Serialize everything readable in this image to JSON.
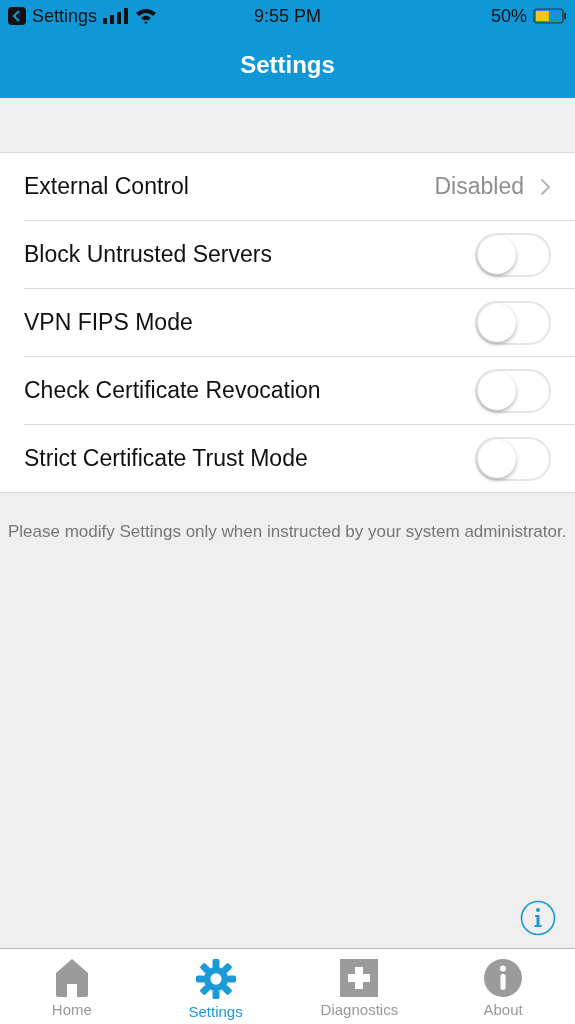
{
  "status_bar": {
    "back_label": "Settings",
    "time": "9:55 PM",
    "battery": "50%"
  },
  "nav_bar": {
    "title": "Settings"
  },
  "settings": [
    {
      "kind": "link",
      "label": "External Control",
      "value": "Disabled"
    },
    {
      "kind": "toggle",
      "label": "Block Untrusted Servers",
      "on": false
    },
    {
      "kind": "toggle",
      "label": "VPN FIPS Mode",
      "on": false
    },
    {
      "kind": "toggle",
      "label": "Check Certificate Revocation",
      "on": false
    },
    {
      "kind": "toggle",
      "label": "Strict Certificate Trust Mode",
      "on": false
    }
  ],
  "footnote": "Please modify Settings only when instructed by your system administrator.",
  "tab_bar": [
    {
      "label": "Home",
      "selected": false
    },
    {
      "label": "Settings",
      "selected": true
    },
    {
      "label": "Diagnostics",
      "selected": false
    },
    {
      "label": "About",
      "selected": false
    }
  ]
}
